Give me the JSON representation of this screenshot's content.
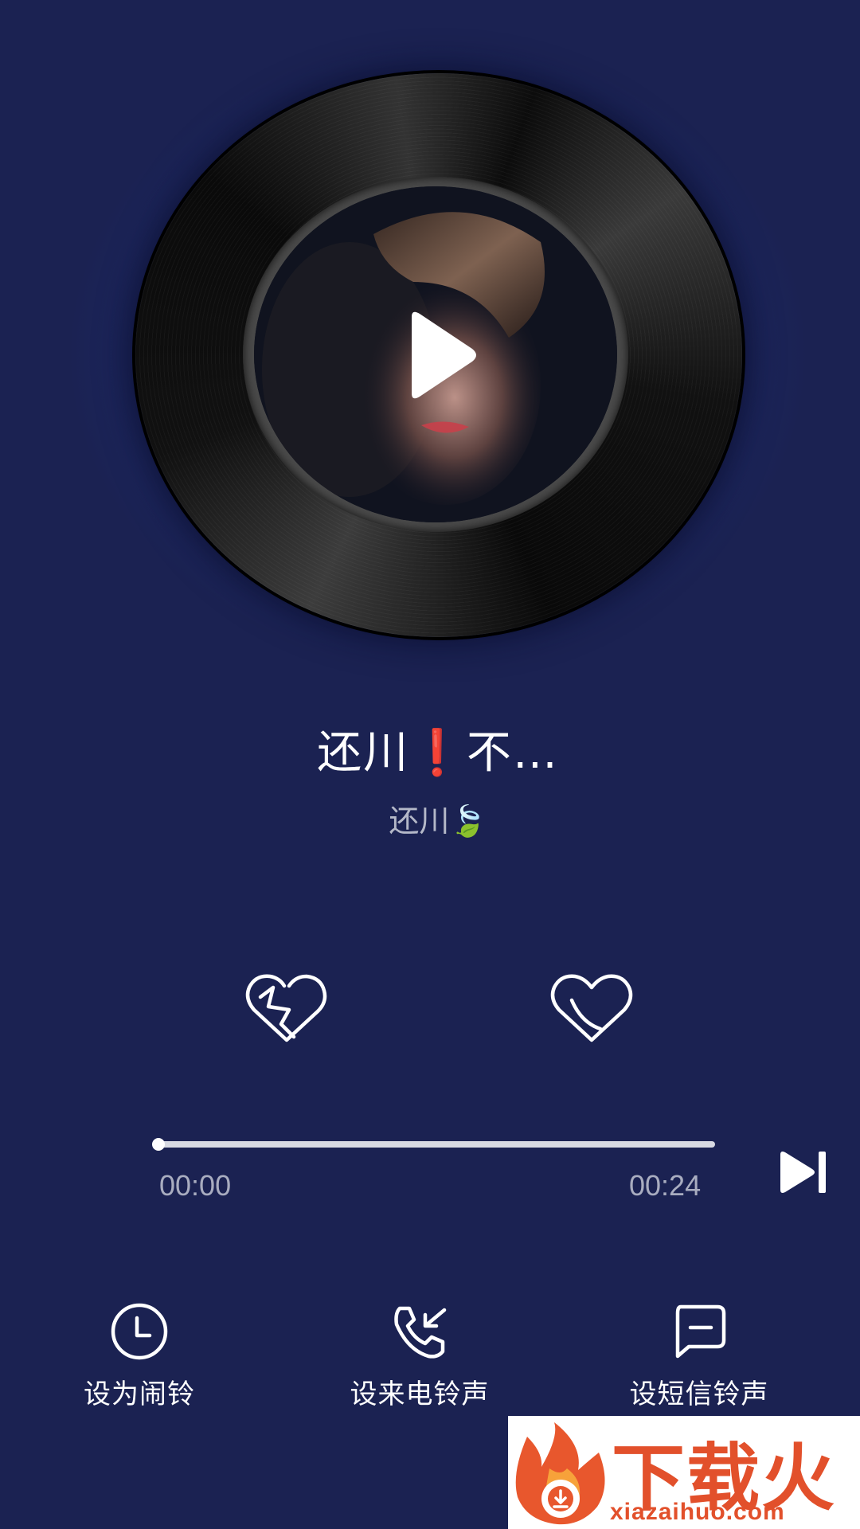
{
  "player": {
    "song_title": "还川❗不…",
    "artist": "还川🍃",
    "current_time": "00:00",
    "total_time": "00:24",
    "progress": 0.0
  },
  "icons": {
    "play": "play-icon",
    "dislike": "broken-heart-icon",
    "like": "heart-icon",
    "next": "skip-next-icon",
    "alarm": "clock-icon",
    "call": "phone-incoming-icon",
    "sms": "message-icon"
  },
  "actions": [
    {
      "label": "设为闹铃"
    },
    {
      "label": "设来电铃声"
    },
    {
      "label": "设短信铃声"
    }
  ],
  "watermark": {
    "text": "下载火",
    "domain": "xiazaihuo.com"
  },
  "colors": {
    "background": "#1b2252",
    "watermark": "#e2502b"
  }
}
